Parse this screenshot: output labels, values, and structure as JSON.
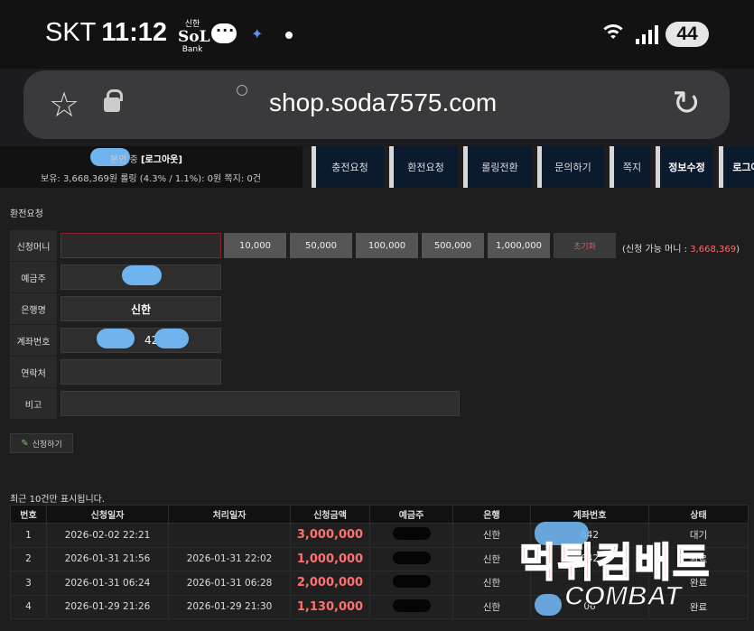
{
  "status_bar": {
    "carrier": "SKT",
    "time": "11:12",
    "bank_app_small": "신한",
    "bank_app_logo": "SoL",
    "bank_app_sub": "Bank",
    "battery": "44"
  },
  "browser": {
    "url": "shop.soda7575.com"
  },
  "header": {
    "login_status": "본인 중",
    "logout_tag": "[로그아웃]",
    "balance_line": "보유: 3,668,369원 롤링 (4.3% / 1.1%): 0원 쪽지: 0건",
    "nav": [
      "충전요청",
      "환전요청",
      "롤링전환",
      "문의하기",
      "쪽지",
      "정보수정",
      "로그아웃"
    ]
  },
  "form": {
    "title": "환전요청",
    "labels": {
      "amount": "신청머니",
      "holder": "예금주",
      "bank": "은행명",
      "account": "계좌번호",
      "contact": "연락처",
      "memo": "비고"
    },
    "amount_buttons": [
      "10,000",
      "50,000",
      "100,000",
      "500,000",
      "1,000,000"
    ],
    "reset_label": "초기화",
    "available_prefix": "(신청 가능 머니 : ",
    "available_value": "3,668,369",
    "available_suffix": ")",
    "bank_value": "신한",
    "account_partial": "42",
    "submit_label": "신청하기"
  },
  "history": {
    "note": "최근 10건만 표시됩니다.",
    "headers": [
      "번호",
      "신청일자",
      "처리일자",
      "신청금액",
      "예금주",
      "은행",
      "계좌번호",
      "상태"
    ],
    "rows": [
      {
        "no": "1",
        "req": "2026-02-02 22:21",
        "done": "",
        "amount": "3,000,000",
        "bank": "신한",
        "acct": "642",
        "status": "대기"
      },
      {
        "no": "2",
        "req": "2026-01-31 21:56",
        "done": "2026-01-31 22:02",
        "amount": "1,000,000",
        "bank": "신한",
        "acct": "642",
        "status": "완료"
      },
      {
        "no": "3",
        "req": "2026-01-31 06:24",
        "done": "2026-01-31 06:28",
        "amount": "2,000,000",
        "bank": "신한",
        "acct": "",
        "status": "완료"
      },
      {
        "no": "4",
        "req": "2026-01-29 21:26",
        "done": "2026-01-29 21:30",
        "amount": "1,130,000",
        "bank": "신한",
        "acct": "06",
        "status": "완료"
      }
    ]
  },
  "watermark": {
    "korean": "먹튀컴배트",
    "english": "COMBAT"
  }
}
